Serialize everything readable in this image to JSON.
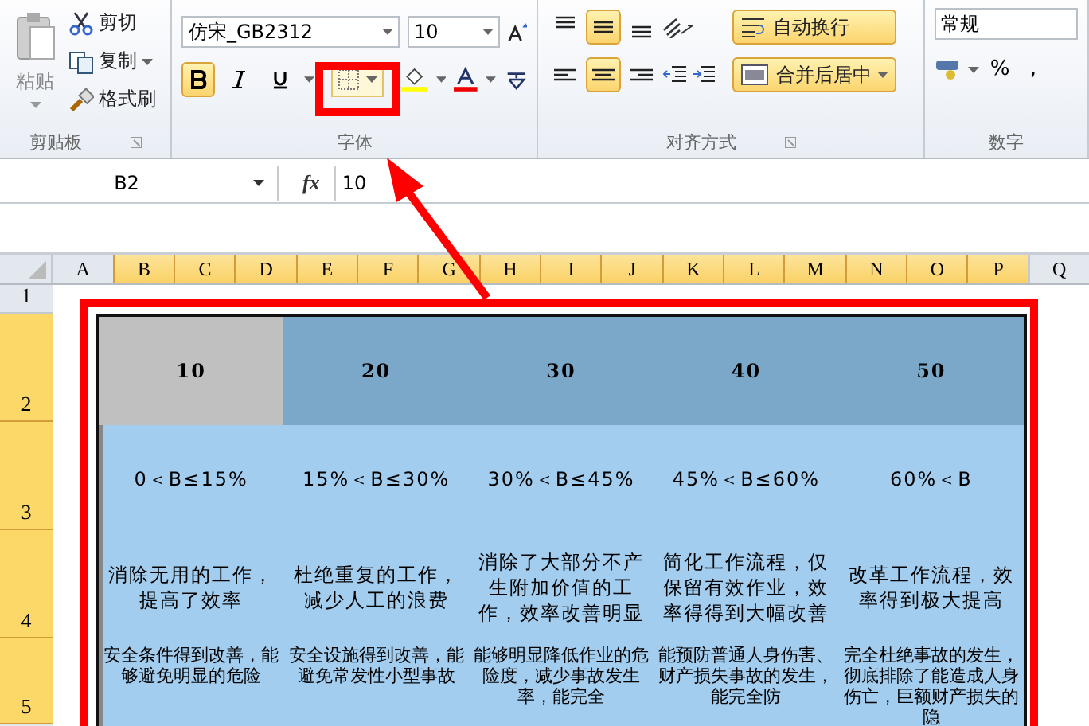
{
  "ribbon": {
    "clipboard": {
      "paste": "粘贴",
      "cut": "剪切",
      "copy": "复制",
      "format_painter": "格式刷",
      "label": "剪贴板"
    },
    "font": {
      "font_name": "仿宋_GB2312",
      "font_size": "10",
      "bold": true,
      "italic": false,
      "underline": false,
      "label": "字体"
    },
    "alignment": {
      "vertical": [
        {
          "kind": "top",
          "selected": false
        },
        {
          "kind": "middle",
          "selected": true
        },
        {
          "kind": "bottom",
          "selected": false
        }
      ],
      "horizontal": [
        {
          "kind": "left",
          "selected": false
        },
        {
          "kind": "center",
          "selected": true
        },
        {
          "kind": "right",
          "selected": false
        }
      ],
      "wrap_text": "自动换行",
      "merge_center": "合并后居中",
      "label": "对齐方式"
    },
    "number": {
      "format": "常规",
      "percent": "%",
      "comma": ",",
      "label": "数字"
    }
  },
  "formula_bar": {
    "name_box": "B2",
    "function_label": "fx",
    "value": "10"
  },
  "columns": [
    {
      "label": "A",
      "selected": false
    },
    {
      "label": "B",
      "selected": true
    },
    {
      "label": "C",
      "selected": true
    },
    {
      "label": "D",
      "selected": true
    },
    {
      "label": "E",
      "selected": true
    },
    {
      "label": "F",
      "selected": true
    },
    {
      "label": "G",
      "selected": true
    },
    {
      "label": "H",
      "selected": true
    },
    {
      "label": "I",
      "selected": true
    },
    {
      "label": "J",
      "selected": true
    },
    {
      "label": "K",
      "selected": true
    },
    {
      "label": "L",
      "selected": true
    },
    {
      "label": "M",
      "selected": true
    },
    {
      "label": "N",
      "selected": true
    },
    {
      "label": "O",
      "selected": true
    },
    {
      "label": "P",
      "selected": true
    },
    {
      "label": "Q",
      "selected": false
    }
  ],
  "rows": [
    {
      "label": "1",
      "selected": false
    },
    {
      "label": "2",
      "selected": true
    },
    {
      "label": "3",
      "selected": true
    },
    {
      "label": "4",
      "selected": true
    },
    {
      "label": "5",
      "selected": true
    }
  ],
  "table": [
    [
      "10",
      "20",
      "30",
      "40",
      "50"
    ],
    [
      "0＜B≤15%",
      "15%＜B≤30%",
      "30%＜B≤45%",
      "45%＜B≤60%",
      "60%＜B"
    ],
    [
      "消除无用的工作，提高了效率",
      "杜绝重复的工作，减少人工的浪费",
      "消除了大部分不产生附加价值的工作，效率改善明显",
      "简化工作流程，仅保留有效作业，效率得得到大幅改善",
      "改革工作流程，效率得到极大提高"
    ],
    [
      "安全条件得到改善，能够避免明显的危险",
      "安全设施得到改善，能避免常发性小型事故",
      "能够明显降低作业的危险度，减少事故发生率，能完全",
      "能预防普通人身伤害、财产损失事故的发生，能完全防",
      "完全杜绝事故的发生，彻底排除了能造成人身伤亡，巨额财产损失的隐"
    ]
  ]
}
